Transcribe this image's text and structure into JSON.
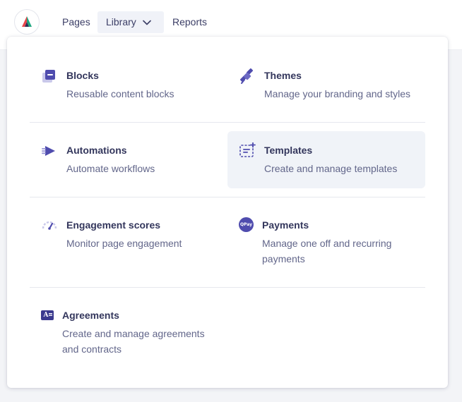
{
  "nav": {
    "logo_icon": "brand-logo-icon",
    "items": [
      {
        "label": "Pages"
      },
      {
        "label": "Library",
        "icon": "chevron-down-icon"
      },
      {
        "label": "Reports"
      }
    ]
  },
  "menu": {
    "items": [
      {
        "title": "Blocks",
        "description": "Reusable content blocks",
        "icon": "blocks-icon"
      },
      {
        "title": "Themes",
        "description": "Manage your branding and styles",
        "icon": "satellite-icon"
      },
      {
        "title": "Automations",
        "description": "Automate workflows",
        "icon": "automation-icon"
      },
      {
        "title": "Templates",
        "description": "Create and manage templates",
        "icon": "template-icon"
      },
      {
        "title": "Engagement scores",
        "description": "Monitor page engagement",
        "icon": "gauge-icon"
      },
      {
        "title": "Payments",
        "description": "Manage one off and recurring payments",
        "icon": "qpay-icon"
      },
      {
        "title": "Agreements",
        "description": "Create and manage agreements and contracts",
        "icon": "agreement-icon"
      }
    ]
  },
  "colors": {
    "accent": "#4f4cae",
    "text": "#33365c",
    "muted": "#62668a",
    "highlight": "#f0f3f8"
  },
  "icon_text": {
    "payments": "QPay",
    "agreements": "A"
  }
}
